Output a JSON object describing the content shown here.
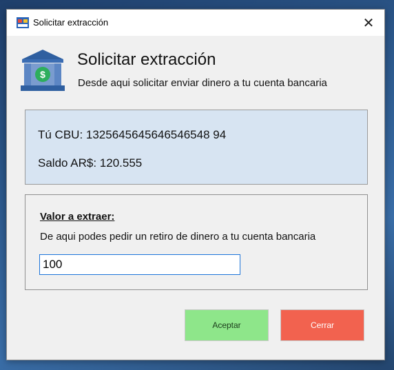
{
  "window": {
    "title": "Solicitar extracción",
    "close_glyph": "✕"
  },
  "header": {
    "title": "Solicitar extracción",
    "subtitle": "Desde aqui solicitar enviar dinero a tu cuenta bancaria",
    "icon": "bank-icon"
  },
  "account": {
    "cbu_text": "Tú CBU: 1325645645646546548 94",
    "saldo_text": "Saldo AR$: 120.555"
  },
  "amount": {
    "label": "Valor a extraer:",
    "description": "De aqui podes pedir un retiro de dinero a tu cuenta bancaria",
    "value": "100"
  },
  "buttons": {
    "accept_label": "Aceptar",
    "close_label": "Cerrar"
  },
  "colors": {
    "accept": "#8ee68a",
    "close": "#f2624f",
    "account_panel": "#d7e4f2",
    "bank_icon": "#2f5fa0"
  }
}
